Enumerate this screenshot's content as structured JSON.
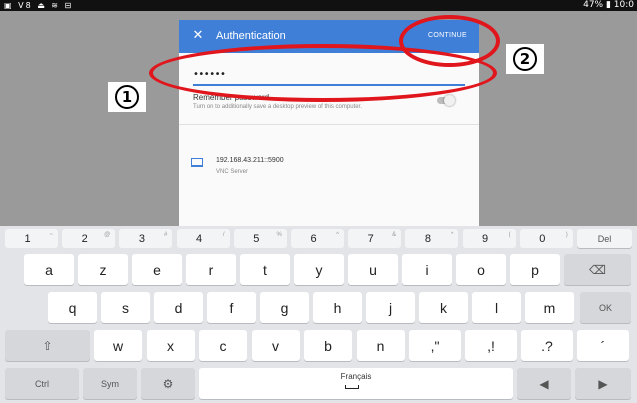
{
  "status_bar": {
    "left_icons": "▣ V8 ⏏ ≋ ⊟",
    "right": "47% ▮ 10:0"
  },
  "dialog": {
    "close_icon": "✕",
    "title": "Authentication",
    "continue_label": "CONTINUE",
    "password_value": "••••••",
    "remember_label": "Remember password",
    "remember_sub": "Turn on to additionally save a desktop preview of this computer.",
    "server_address": "192.168.43.211::5900",
    "server_type": "VNC Server"
  },
  "callouts": {
    "one": "1",
    "two": "2",
    "color": "#e0161c"
  },
  "keyboard": {
    "number_row": [
      {
        "key": "1",
        "sub": "~"
      },
      {
        "key": "2",
        "sub": "@"
      },
      {
        "key": "3",
        "sub": "#"
      },
      {
        "key": "4",
        "sub": "/"
      },
      {
        "key": "5",
        "sub": "%"
      },
      {
        "key": "6",
        "sub": "^"
      },
      {
        "key": "7",
        "sub": "&"
      },
      {
        "key": "8",
        "sub": "*"
      },
      {
        "key": "9",
        "sub": "("
      },
      {
        "key": "0",
        "sub": ")"
      }
    ],
    "del_label": "Del",
    "row1": [
      "a",
      "z",
      "e",
      "r",
      "t",
      "y",
      "u",
      "i",
      "o",
      "p"
    ],
    "backspace_icon": "⌫",
    "row2": [
      "q",
      "s",
      "d",
      "f",
      "g",
      "h",
      "j",
      "k",
      "l",
      "m"
    ],
    "ok_label": "OK",
    "shift_icon": "⇧",
    "row3": [
      "w",
      "x",
      "c",
      "v",
      "b",
      "n"
    ],
    "punct": [
      ",\"",
      ",!",
      ".?",
      "´"
    ],
    "ctrl_label": "Ctrl",
    "sym_label": "Sym",
    "settings_icon": "⚙",
    "space_label": "Français",
    "left_arrow": "◀",
    "right_arrow": "▶"
  },
  "accent_color": "#3f7fd8"
}
